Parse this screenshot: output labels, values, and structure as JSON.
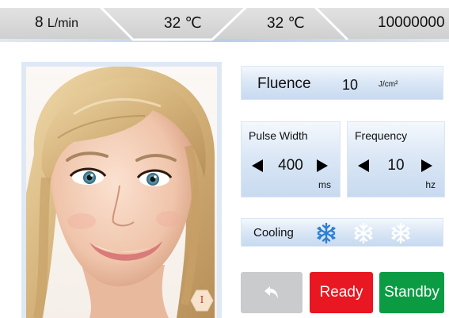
{
  "status_bar": {
    "flow_value": "8",
    "flow_unit": "L/min",
    "temperature_1": "32 ℃",
    "temperature_2": "32 ℃",
    "shot_counter": "10000000"
  },
  "photo": {
    "subject": "smiling blonde woman portrait",
    "hex_button_label": "I"
  },
  "fluence": {
    "label": "Fluence",
    "value": "10",
    "unit": "J/cm²"
  },
  "pulse_width": {
    "label": "Pulse Width",
    "value": "400",
    "unit": "ms",
    "decrease_icon": "left-arrow-icon",
    "increase_icon": "right-arrow-icon"
  },
  "frequency": {
    "label": "Frequency",
    "value": "10",
    "unit": "hz",
    "decrease_icon": "left-arrow-icon",
    "increase_icon": "right-arrow-icon"
  },
  "cooling": {
    "label": "Cooling",
    "level": 1,
    "max_level": 3,
    "icon": "snowflake-icon"
  },
  "buttons": {
    "back_icon": "undo-arrow-icon",
    "ready": "Ready",
    "standby": "Standby"
  },
  "colors": {
    "ready": "#e81721",
    "standby": "#0b9c43",
    "back": "#c9cbcc",
    "snowflake_active": "#2f7fd0",
    "snowflake_inactive": "#ffffff"
  }
}
